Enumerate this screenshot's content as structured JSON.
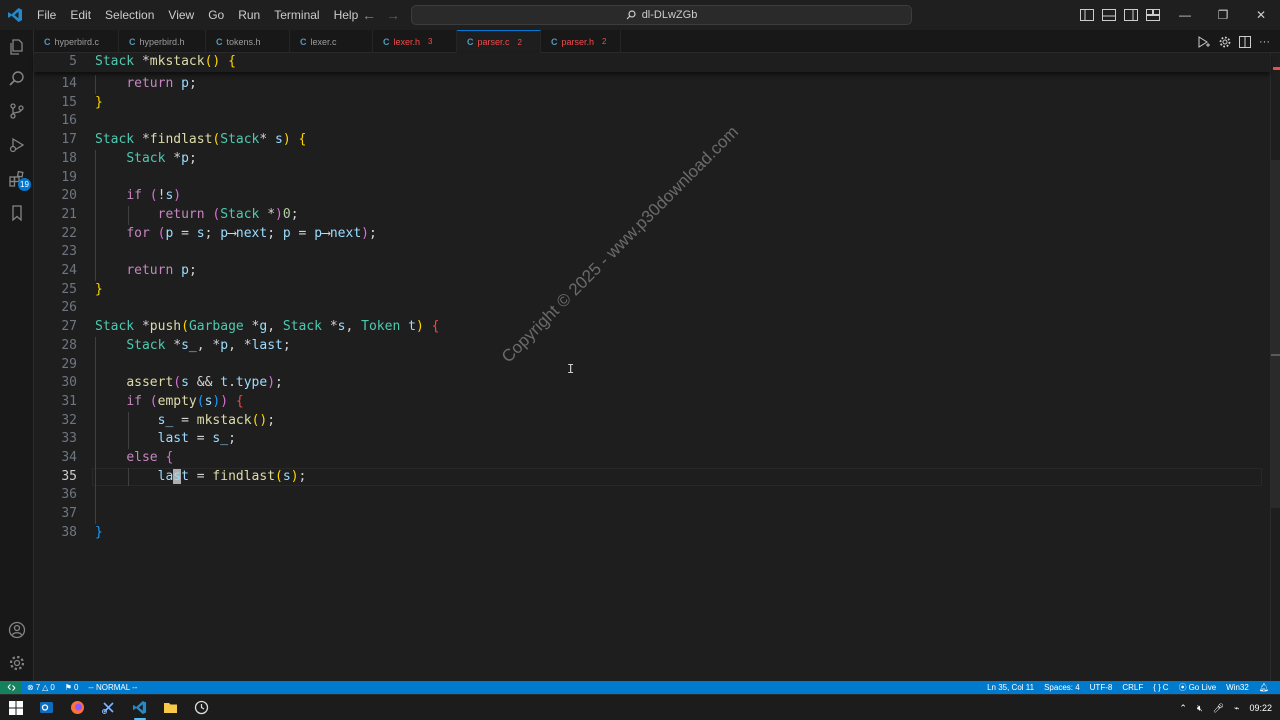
{
  "menu": [
    "File",
    "Edit",
    "Selection",
    "View",
    "Go",
    "Run",
    "Terminal",
    "Help"
  ],
  "command_center": {
    "text": "dl-DLwZGb",
    "icon": "search-icon"
  },
  "tabs": [
    {
      "label": "hyperbird.c",
      "kind": "C",
      "error": false,
      "count": "",
      "active": false,
      "dirty": false
    },
    {
      "label": "hyperbird.h",
      "kind": "C",
      "error": false,
      "count": "",
      "active": false,
      "dirty": false
    },
    {
      "label": "tokens.h",
      "kind": "C",
      "error": false,
      "count": "",
      "active": false,
      "dirty": false
    },
    {
      "label": "lexer.c",
      "kind": "C",
      "error": false,
      "count": "",
      "active": false,
      "dirty": false
    },
    {
      "label": "lexer.h",
      "kind": "C",
      "error": true,
      "count": "3",
      "active": false,
      "dirty": false
    },
    {
      "label": "parser.c",
      "kind": "C",
      "error": true,
      "count": "2",
      "active": true,
      "dirty": true
    },
    {
      "label": "parser.h",
      "kind": "C",
      "error": true,
      "count": "2",
      "active": false,
      "dirty": false
    }
  ],
  "editor": {
    "sticky": {
      "number": "5",
      "segments": [
        [
          "t",
          "Stack"
        ],
        [
          "op",
          " *"
        ],
        [
          "f",
          "mkstack"
        ],
        [
          "p1",
          "()"
        ],
        [
          "op",
          " "
        ],
        [
          "p1",
          "{"
        ]
      ]
    },
    "current_line": "35",
    "lines": [
      {
        "number": "14",
        "segments": [
          [
            "op",
            "    "
          ],
          [
            "ctl",
            "return"
          ],
          [
            "op",
            " "
          ],
          [
            "v",
            "p"
          ],
          [
            "op",
            ";"
          ]
        ]
      },
      {
        "number": "15",
        "segments": [
          [
            "p1",
            "}"
          ]
        ]
      },
      {
        "number": "16",
        "segments": []
      },
      {
        "number": "17",
        "segments": [
          [
            "t",
            "Stack"
          ],
          [
            "op",
            " *"
          ],
          [
            "f",
            "findlast"
          ],
          [
            "p1",
            "("
          ],
          [
            "t",
            "Stack"
          ],
          [
            "op",
            "* "
          ],
          [
            "v",
            "s"
          ],
          [
            "p1",
            ")"
          ],
          [
            "op",
            " "
          ],
          [
            "p1",
            "{"
          ]
        ]
      },
      {
        "number": "18",
        "segments": [
          [
            "op",
            "    "
          ],
          [
            "t",
            "Stack"
          ],
          [
            "op",
            " *"
          ],
          [
            "v",
            "p"
          ],
          [
            "op",
            ";"
          ]
        ]
      },
      {
        "number": "19",
        "segments": []
      },
      {
        "number": "20",
        "segments": [
          [
            "op",
            "    "
          ],
          [
            "ctl",
            "if"
          ],
          [
            "op",
            " "
          ],
          [
            "p2",
            "("
          ],
          [
            "op",
            "!"
          ],
          [
            "v",
            "s"
          ],
          [
            "p2",
            ")"
          ]
        ]
      },
      {
        "number": "21",
        "segments": [
          [
            "op",
            "        "
          ],
          [
            "ctl",
            "return"
          ],
          [
            "op",
            " "
          ],
          [
            "p2",
            "("
          ],
          [
            "t",
            "Stack"
          ],
          [
            "op",
            " *"
          ],
          [
            "p2",
            ")"
          ],
          [
            "n",
            "0"
          ],
          [
            "op",
            ";"
          ]
        ]
      },
      {
        "number": "22",
        "segments": [
          [
            "op",
            "    "
          ],
          [
            "ctl",
            "for"
          ],
          [
            "op",
            " "
          ],
          [
            "p2",
            "("
          ],
          [
            "v",
            "p"
          ],
          [
            "op",
            " = "
          ],
          [
            "v",
            "s"
          ],
          [
            "op",
            "; "
          ],
          [
            "v",
            "p"
          ],
          [
            "op",
            "⟶"
          ],
          [
            "v",
            "next"
          ],
          [
            "op",
            "; "
          ],
          [
            "v",
            "p"
          ],
          [
            "op",
            " = "
          ],
          [
            "v",
            "p"
          ],
          [
            "op",
            "⟶"
          ],
          [
            "v",
            "next"
          ],
          [
            "p2",
            ")"
          ],
          [
            "op",
            ";"
          ]
        ]
      },
      {
        "number": "23",
        "segments": []
      },
      {
        "number": "24",
        "segments": [
          [
            "op",
            "    "
          ],
          [
            "ctl",
            "return"
          ],
          [
            "op",
            " "
          ],
          [
            "v",
            "p"
          ],
          [
            "op",
            ";"
          ]
        ]
      },
      {
        "number": "25",
        "segments": [
          [
            "p1",
            "}"
          ]
        ]
      },
      {
        "number": "26",
        "segments": []
      },
      {
        "number": "27",
        "segments": [
          [
            "t",
            "Stack"
          ],
          [
            "op",
            " *"
          ],
          [
            "f",
            "push"
          ],
          [
            "p1",
            "("
          ],
          [
            "t",
            "Garbage"
          ],
          [
            "op",
            " *"
          ],
          [
            "v",
            "g"
          ],
          [
            "op",
            ", "
          ],
          [
            "t",
            "Stack"
          ],
          [
            "op",
            " *"
          ],
          [
            "v",
            "s"
          ],
          [
            "op",
            ", "
          ],
          [
            "t",
            "Token"
          ],
          [
            "op",
            " "
          ],
          [
            "v",
            "t"
          ],
          [
            "p1",
            ")"
          ],
          [
            "op",
            " "
          ],
          [
            "bad",
            "{"
          ]
        ]
      },
      {
        "number": "28",
        "segments": [
          [
            "op",
            "    "
          ],
          [
            "t",
            "Stack"
          ],
          [
            "op",
            " *"
          ],
          [
            "v",
            "s_"
          ],
          [
            "op",
            ", *"
          ],
          [
            "v",
            "p"
          ],
          [
            "op",
            ", *"
          ],
          [
            "v",
            "last"
          ],
          [
            "op",
            ";"
          ]
        ]
      },
      {
        "number": "29",
        "segments": []
      },
      {
        "number": "30",
        "segments": [
          [
            "op",
            "    "
          ],
          [
            "f",
            "assert"
          ],
          [
            "p2",
            "("
          ],
          [
            "v",
            "s"
          ],
          [
            "op",
            " && "
          ],
          [
            "v",
            "t"
          ],
          [
            "op",
            "."
          ],
          [
            "v",
            "type"
          ],
          [
            "p2",
            ")"
          ],
          [
            "op",
            ";"
          ]
        ]
      },
      {
        "number": "31",
        "segments": [
          [
            "op",
            "    "
          ],
          [
            "ctl",
            "if"
          ],
          [
            "op",
            " "
          ],
          [
            "p2",
            "("
          ],
          [
            "f",
            "empty"
          ],
          [
            "p3",
            "("
          ],
          [
            "v",
            "s"
          ],
          [
            "p3",
            ")"
          ],
          [
            "p2",
            ")"
          ],
          [
            "op",
            " "
          ],
          [
            "bad",
            "{"
          ]
        ]
      },
      {
        "number": "32",
        "segments": [
          [
            "op",
            "        "
          ],
          [
            "v",
            "s_"
          ],
          [
            "op",
            " = "
          ],
          [
            "f",
            "mkstack"
          ],
          [
            "p1",
            "()"
          ],
          [
            "op",
            ";"
          ]
        ]
      },
      {
        "number": "33",
        "segments": [
          [
            "op",
            "        "
          ],
          [
            "v",
            "last"
          ],
          [
            "op",
            " = "
          ],
          [
            "v",
            "s_"
          ],
          [
            "op",
            ";"
          ]
        ]
      },
      {
        "number": "34",
        "segments": [
          [
            "op",
            "    "
          ],
          [
            "ctl",
            "else"
          ],
          [
            "op",
            " "
          ],
          [
            "p2",
            "{"
          ]
        ]
      },
      {
        "number": "35",
        "segments": [
          [
            "op",
            "        "
          ],
          [
            "v",
            "la"
          ],
          [
            "cur",
            "s"
          ],
          [
            "v",
            "t"
          ],
          [
            "op",
            " = "
          ],
          [
            "f",
            "findlast"
          ],
          [
            "p1",
            "("
          ],
          [
            "v",
            "s"
          ],
          [
            "p1",
            ")"
          ],
          [
            "op",
            ";"
          ]
        ]
      },
      {
        "number": "36",
        "segments": []
      },
      {
        "number": "37",
        "segments": []
      },
      {
        "number": "38",
        "segments": [
          [
            "p3",
            "}"
          ]
        ]
      }
    ]
  },
  "watermark": "Copyright © 2025 - www.p30download.com",
  "status": {
    "errors": "7",
    "warnings": "0",
    "info": "0",
    "mode": "-- NORMAL --",
    "position": "Ln 35, Col 11",
    "spaces": "Spaces: 4",
    "encoding": "UTF-8",
    "eol": "CRLF",
    "language": "C",
    "golive": "Go Live",
    "platform": "Win32"
  },
  "taskbar": {
    "time": "09:22"
  },
  "colors": {
    "accent": "#007acc",
    "remote": "#16825d",
    "error": "#f14c4c"
  }
}
